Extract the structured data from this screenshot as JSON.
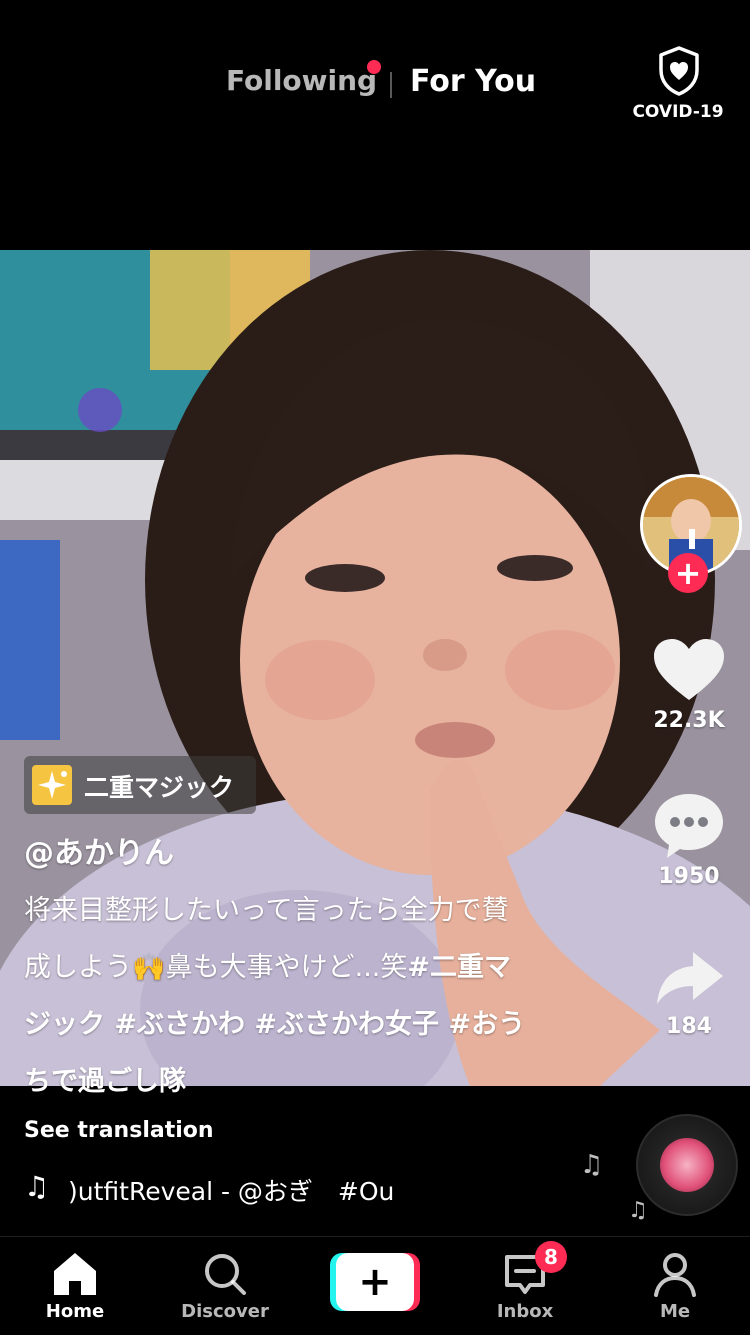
{
  "top_bar": {
    "following_label": "Following",
    "for_you_label": "For You",
    "covid_label": "COVID-19",
    "covid_icon": "shield-heart-icon"
  },
  "video": {
    "effect": {
      "label": "二重マジック",
      "icon": "effect-sparkle-icon"
    },
    "username": "@あかりん",
    "caption_lines": [
      "将来目整形したいって言ったら全力で賛",
      "成しよう🙌鼻も大事やけど...笑",
      "ジック #ぶさかわ #ぶさかわ女子 #おう",
      "ちで過ごし隊"
    ],
    "caption_tag_inline": "#二重マ",
    "see_translation": "See translation",
    "music_text": ")utfitReveal - @おぎ　#Ou",
    "music_icon": "music-note-icon"
  },
  "actions": {
    "likes": "22.3K",
    "comments": "1950",
    "shares": "184",
    "like_icon": "heart-icon",
    "comment_icon": "comment-bubble-icon",
    "share_icon": "share-arrow-icon"
  },
  "bottom_nav": {
    "home_label": "Home",
    "discover_label": "Discover",
    "inbox_label": "Inbox",
    "me_label": "Me",
    "inbox_badge": "8"
  },
  "colors": {
    "accent_red": "#fe2c55",
    "accent_cyan": "#25f4ee",
    "background": "#000000"
  }
}
